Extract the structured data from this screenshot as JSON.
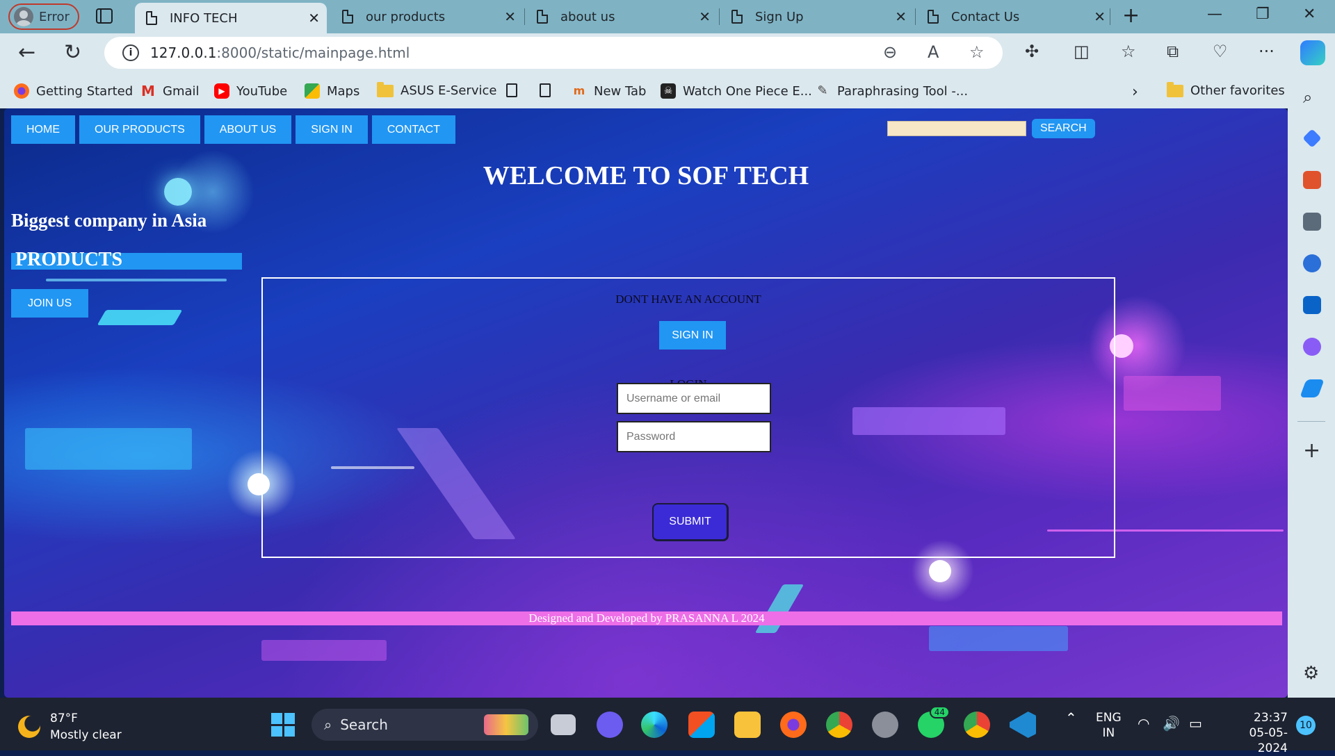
{
  "browser": {
    "profile_label": "Error",
    "tabs": [
      {
        "title": "INFO TECH",
        "active": true
      },
      {
        "title": "our products",
        "active": false
      },
      {
        "title": "about us",
        "active": false
      },
      {
        "title": "Sign Up",
        "active": false
      },
      {
        "title": "Contact Us",
        "active": false
      }
    ],
    "url_host": "127.0.0.1",
    "url_path": ":8000/static/mainpage.html",
    "bookmarks": [
      {
        "label": "Getting Started",
        "icon": "firefox-icon"
      },
      {
        "label": "Gmail",
        "icon": "gmail-icon"
      },
      {
        "label": "YouTube",
        "icon": "youtube-icon"
      },
      {
        "label": "Maps",
        "icon": "maps-icon"
      },
      {
        "label": "ASUS E-Service",
        "icon": "folder-icon"
      },
      {
        "label": "New Tab",
        "icon": "page-icon"
      },
      {
        "label": "Watch One Piece E...",
        "icon": "site-icon"
      },
      {
        "label": "Paraphrasing Tool -...",
        "icon": "quill-icon"
      }
    ],
    "other_favorites": "Other favorites"
  },
  "site": {
    "nav": [
      "HOME",
      "OUR PRODUCTS",
      "ABOUT US",
      "SIGN IN",
      "CONTACT"
    ],
    "search_button": "SEARCH",
    "search_value": "",
    "welcome": "WELCOME TO SOF TECH",
    "tagline": "Biggest company in Asia",
    "products_label": "PRODUCTS",
    "join_button": "JOIN US",
    "form": {
      "no_account": "DONT HAVE AN ACCOUNT",
      "signin_button": "SIGN IN",
      "login_heading": "LOGIN",
      "username_placeholder": "Username or email",
      "password_placeholder": "Password",
      "submit_button": "SUBMIT"
    },
    "footer": "Designed and Developed by PRASANNA L 2024"
  },
  "taskbar": {
    "temperature": "87°F",
    "weather": "Mostly clear",
    "search_label": "Search",
    "whatsapp_badge": "44",
    "lang": "ENG",
    "region": "IN",
    "time": "23:37",
    "date": "05-05-2024",
    "notifications": "10"
  },
  "colors": {
    "nav_button": "#2196f3",
    "submit": "#3b2bd6",
    "footer_bar": "#ee6ee8",
    "search_field": "#f7e7c7"
  }
}
